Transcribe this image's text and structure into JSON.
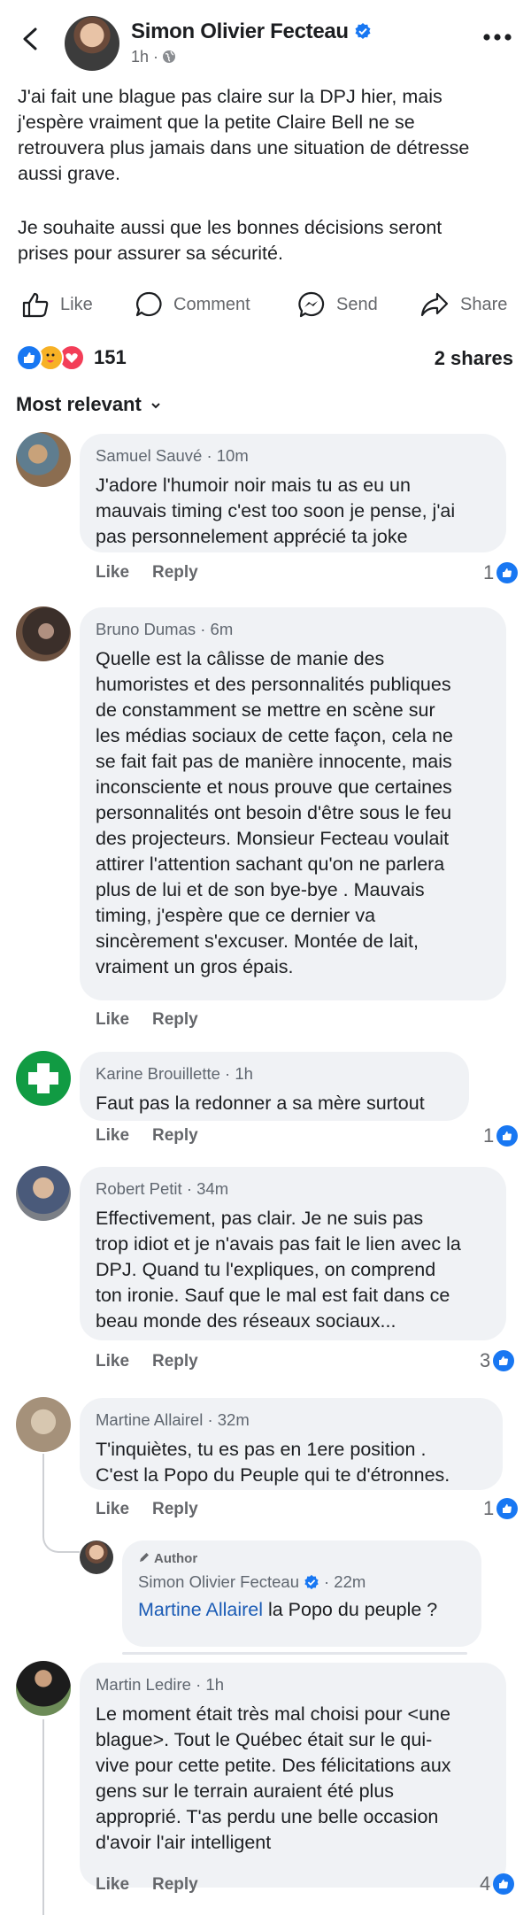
{
  "post": {
    "author": "Simon Olivier Fecteau",
    "time": "1h ·",
    "paragraph1_lines": [
      "J'ai fait une blague pas claire sur la DPJ hier, mais",
      "j'espère vraiment que la petite Claire Bell ne se",
      "retrouvera plus jamais dans une situation de détresse",
      "aussi grave."
    ],
    "paragraph2_lines": [
      "Je souhaite aussi que les bonnes décisions seront",
      "prises pour assurer sa sécurité."
    ]
  },
  "actions": {
    "like": "Like",
    "comment": "Comment",
    "send": "Send",
    "share": "Share"
  },
  "stats": {
    "reactions": "151",
    "shares": "2 shares"
  },
  "sort": "Most relevant",
  "colors": {
    "accent": "#1877f2",
    "love": "#f33e58",
    "care": "#f7b125",
    "bubble": "#f0f2f5",
    "muted": "#65676b",
    "link": "#1a5bb5"
  },
  "icons": [
    "back-icon",
    "verified-badge-icon",
    "globe-icon",
    "more-icon",
    "like-icon",
    "comment-icon",
    "messenger-icon",
    "share-icon",
    "like-reaction-icon",
    "care-reaction-icon",
    "love-reaction-icon",
    "chevron-down-icon",
    "author-pen-icon"
  ],
  "comments": [
    {
      "name": "Samuel Sauvé",
      "time": "· 10m",
      "lines": [
        "J'adore l'humoir noir mais tu as eu un",
        "mauvais timing c'est too soon je pense, j'ai",
        "pas personnelement apprécié ta joke"
      ],
      "like": "Like",
      "reply": "Reply",
      "likes": "1"
    },
    {
      "name": "Bruno Dumas",
      "time": "· 6m",
      "lines": [
        "Quelle est la câlisse de manie des",
        "humoristes et des personnalités publiques",
        "de constamment se mettre en scène sur",
        "les médias sociaux de cette façon, cela ne",
        "se fait fait pas de manière innocente, mais",
        "inconsciente et nous prouve que certaines",
        "personnalités ont besoin d'être sous le feu",
        "des projecteurs. Monsieur Fecteau voulait",
        "attirer l'attention sachant qu'on ne parlera",
        "plus de lui et de son bye-bye . Mauvais",
        "timing, j'espère que  ce dernier va",
        "sincèrement s'excuser. Montée de lait,",
        "vraiment un gros épais."
      ],
      "like": "Like",
      "reply": "Reply"
    },
    {
      "name": "Karine Brouillette",
      "time": "· 1h",
      "lines": [
        "Faut pas la redonner a sa mère surtout"
      ],
      "like": "Like",
      "reply": "Reply",
      "likes": "1"
    },
    {
      "name": "Robert Petit",
      "time": "· 34m",
      "lines": [
        "Effectivement, pas clair. Je  ne suis pas",
        "trop idiot et je n'avais pas fait le lien avec la",
        "DPJ. Quand tu l'expliques, on comprend",
        "ton ironie. Sauf que le mal est fait dans ce",
        "beau monde des réseaux sociaux..."
      ],
      "like": "Like",
      "reply": "Reply",
      "likes": "3"
    },
    {
      "name": "Martine Allairel",
      "time": "· 32m",
      "lines": [
        "T'inquiètes,  tu es pas en 1ere position .",
        "C'est la Popo du Peuple qui te d'étronnes."
      ],
      "like": "Like",
      "reply": "Reply",
      "likes": "1"
    },
    {
      "name": "Martin Ledire",
      "time": "· 1h",
      "lines": [
        "Le moment était très mal choisi pour <une",
        "blague>. Tout le Québec était sur le qui-",
        "vive pour cette petite. Des félicitations aux",
        "gens sur le terrain auraient été plus",
        "approprié. T'as perdu une belle occasion",
        "d'avoir l'air intelligent"
      ],
      "like": "Like",
      "reply": "Reply",
      "likes": "4"
    }
  ],
  "reply": {
    "badge": "Author",
    "name": "Simon Olivier Fecteau",
    "time": "· 22m",
    "mention": "Martine Allairel",
    "text": " la Popo du peuple ?"
  }
}
